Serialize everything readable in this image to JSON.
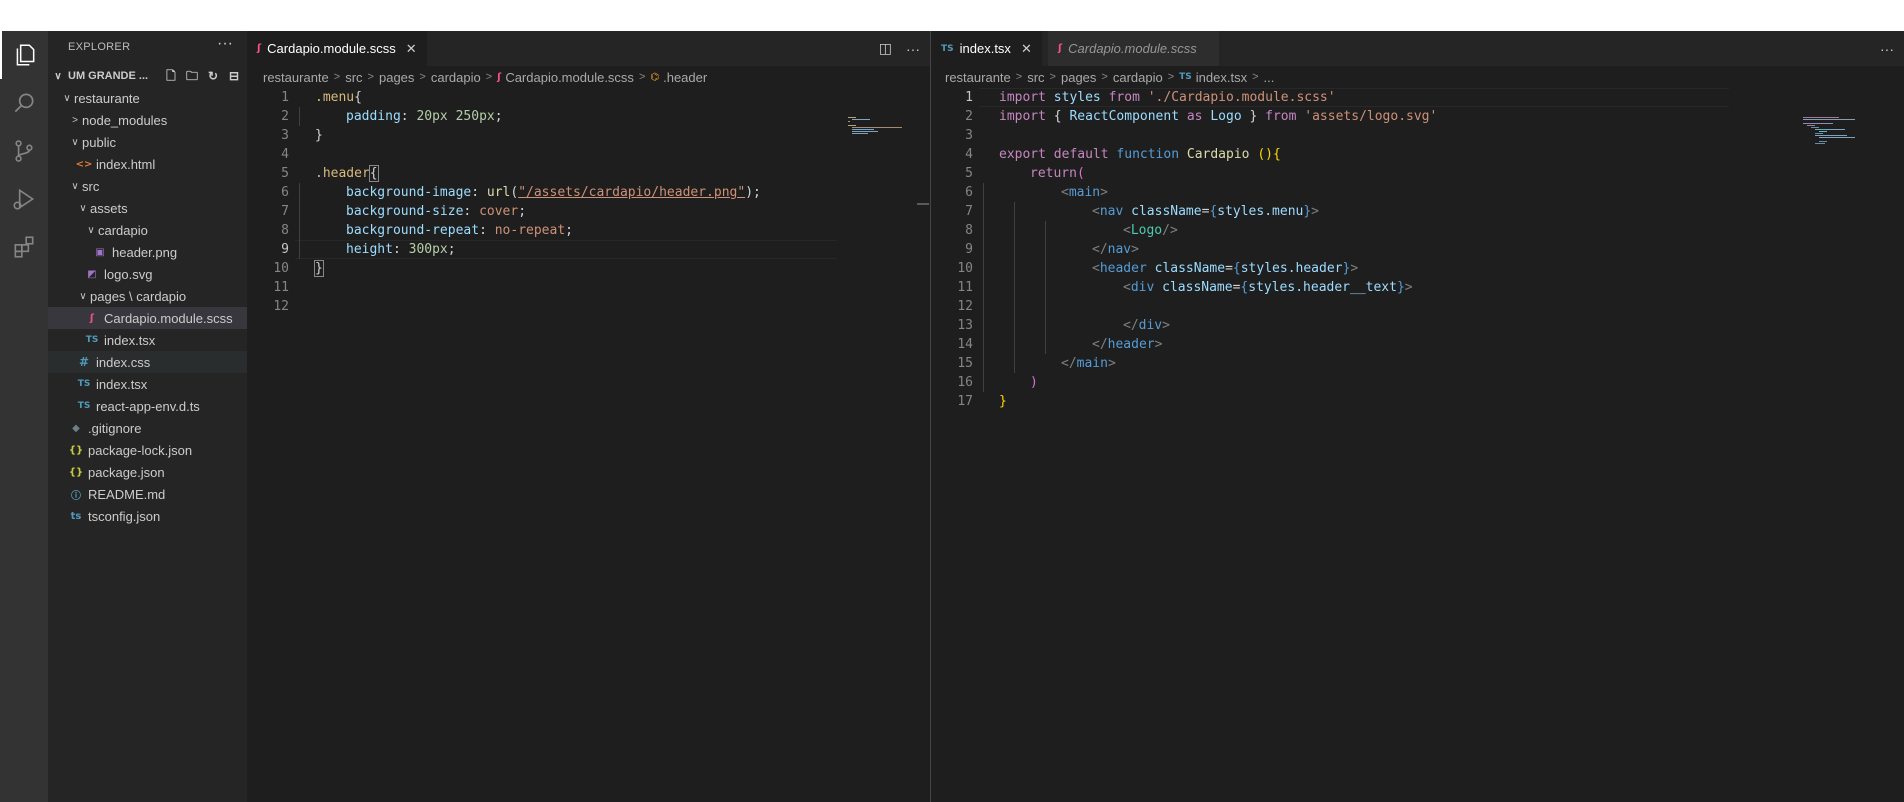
{
  "explorer": {
    "title": "EXPLORER",
    "more": "···",
    "workspace": "UM GRANDE ...",
    "tree": [
      {
        "label": "restaurante",
        "twisty": "∨",
        "icon": ""
      },
      {
        "label": "node_modules",
        "twisty": ">",
        "icon": ""
      },
      {
        "label": "public",
        "twisty": "∨",
        "icon": ""
      },
      {
        "label": "index.html",
        "twisty": "",
        "icon": "<>"
      },
      {
        "label": "src",
        "twisty": "∨",
        "icon": ""
      },
      {
        "label": "assets",
        "twisty": "∨",
        "icon": ""
      },
      {
        "label": "cardapio",
        "twisty": "∨",
        "icon": ""
      },
      {
        "label": "header.png",
        "twisty": "",
        "icon": "▣"
      },
      {
        "label": "logo.svg",
        "twisty": "",
        "icon": "◩"
      },
      {
        "label": "pages \\ cardapio",
        "twisty": "∨",
        "icon": ""
      },
      {
        "label": "Cardapio.module.scss",
        "twisty": "",
        "icon": "ʃ"
      },
      {
        "label": "index.tsx",
        "twisty": "",
        "icon": "TS"
      },
      {
        "label": "index.css",
        "twisty": "",
        "icon": "#"
      },
      {
        "label": "index.tsx",
        "twisty": "",
        "icon": "TS"
      },
      {
        "label": "react-app-env.d.ts",
        "twisty": "",
        "icon": "TS"
      },
      {
        "label": ".gitignore",
        "twisty": "",
        "icon": "◆"
      },
      {
        "label": "package-lock.json",
        "twisty": "",
        "icon": "{}"
      },
      {
        "label": "package.json",
        "twisty": "",
        "icon": "{}"
      },
      {
        "label": "README.md",
        "twisty": "",
        "icon": "ⓘ"
      },
      {
        "label": "tsconfig.json",
        "twisty": "",
        "icon": "ts"
      }
    ]
  },
  "group1": {
    "tab": {
      "icon": "ʃ",
      "label": "Cardapio.module.scss",
      "close": "✕"
    },
    "actions": {
      "split": "◫",
      "more": "···"
    },
    "breadcrumb": [
      "restaurante",
      "src",
      "pages",
      "cardapio",
      "Cardapio.module.scss",
      ".header"
    ],
    "line_numbers": [
      "1",
      "2",
      "3",
      "4",
      "5",
      "6",
      "7",
      "8",
      "9",
      "10",
      "11",
      "12"
    ],
    "code": {
      "l1a": ".menu",
      "l1b": "{",
      "l2a": "padding",
      "l2b": ": ",
      "l2c": "20px 250px",
      "l2d": ";",
      "l3": "}",
      "l5a": ".header",
      "l5b": "{",
      "l6a": "background-image",
      "l6b": ": ",
      "l6c": "url",
      "l6d": "(",
      "l6e": "\"/assets/cardapio/header.png\"",
      "l6f": ");",
      "l7a": "background-size",
      "l7b": ": ",
      "l7c": "cover",
      "l7d": ";",
      "l8a": "background-repeat",
      "l8b": ": ",
      "l8c": "no-repeat",
      "l8d": ";",
      "l9a": "height",
      "l9b": ": ",
      "l9c": "300px",
      "l9d": ";",
      "l10": "}"
    }
  },
  "group2": {
    "tabs": [
      {
        "icon": "TS",
        "label": "index.tsx",
        "close": "✕"
      },
      {
        "icon": "ʃ",
        "label": "Cardapio.module.scss"
      }
    ],
    "actions": {
      "more": "···"
    },
    "breadcrumb": [
      "restaurante",
      "src",
      "pages",
      "cardapio",
      "index.tsx",
      "..."
    ],
    "line_numbers": [
      "1",
      "2",
      "3",
      "4",
      "5",
      "6",
      "7",
      "8",
      "9",
      "10",
      "11",
      "12",
      "13",
      "14",
      "15",
      "16",
      "17"
    ],
    "code": {
      "l1a": "import",
      "l1b": " styles ",
      "l1c": "from",
      "l1d": " './Cardapio.module.scss'",
      "l2a": "import",
      "l2b": " { ",
      "l2c": "ReactComponent",
      "l2d": " as ",
      "l2e": "Logo",
      "l2f": " } ",
      "l2g": "from",
      "l2h": " 'assets/logo.svg'",
      "l4a": "export",
      "l4b": " default ",
      "l4c": "function",
      "l4d": " Cardapio",
      "l4e": " (){",
      "l5a": "return",
      "l5b": "(",
      "l6a": "<",
      "l6b": "main",
      "l6c": ">",
      "l7a": "<",
      "l7b": "nav",
      "l7c": " className",
      "l7d": "=",
      "l7e": "{",
      "l7f": "styles.menu",
      "l7g": "}",
      "l7h": ">",
      "l8a": "<",
      "l8b": "Logo",
      "l8c": "/>",
      "l9a": "</",
      "l9b": "nav",
      "l9c": ">",
      "l10a": "<",
      "l10b": "header",
      "l10c": " className",
      "l10d": "=",
      "l10e": "{",
      "l10f": "styles.header",
      "l10g": "}",
      "l10h": ">",
      "l11a": "<",
      "l11b": "div",
      "l11c": " className",
      "l11d": "=",
      "l11e": "{",
      "l11f": "styles.header__text",
      "l11g": "}",
      "l11h": ">",
      "l13a": "</",
      "l13b": "div",
      "l13c": ">",
      "l14a": "</",
      "l14b": "header",
      "l14c": ">",
      "l15a": "</",
      "l15b": "main",
      "l15c": ">",
      "l16": ")",
      "l17": "}"
    }
  }
}
